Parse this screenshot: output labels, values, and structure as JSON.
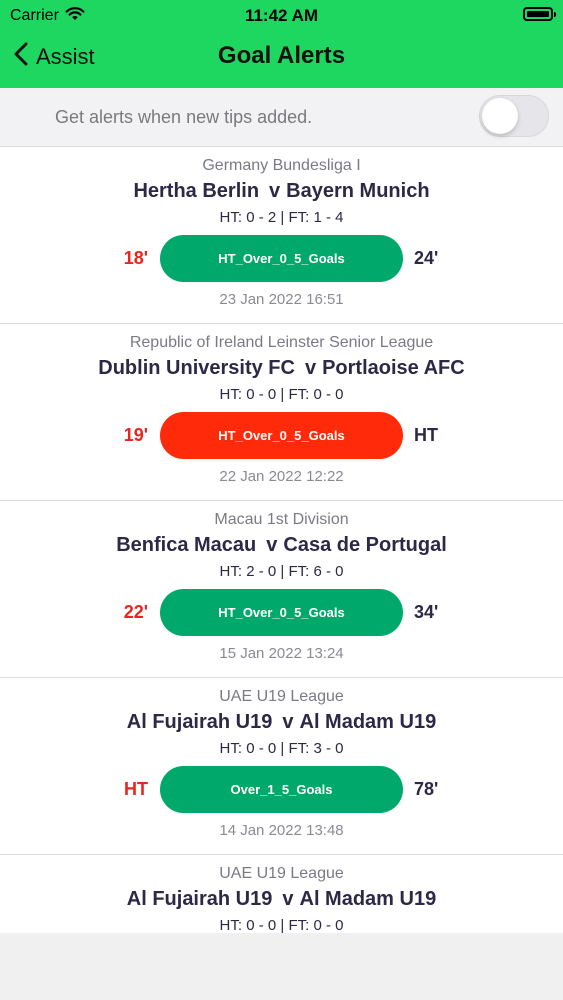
{
  "status_bar": {
    "carrier": "Carrier",
    "time": "11:42 AM",
    "wifi_icon": "wifi-icon",
    "battery_icon": "battery-icon"
  },
  "nav": {
    "back_label": "Assist",
    "title": "Goal Alerts"
  },
  "toggle": {
    "label": "Get alerts when new tips added.",
    "on": false
  },
  "colors": {
    "bar_green": "#1ed760",
    "pill_green": "#00a86b",
    "pill_red": "#ff2a0a",
    "minute_red": "#e8261c",
    "text_dark": "#2c2845"
  },
  "alerts": [
    {
      "league": "Germany Bundesliga I",
      "home": "Hertha Berlin",
      "vs": "v",
      "away": "Bayern Munich",
      "score": "HT: 0 - 2 | FT: 1 - 4",
      "tip_minute": "18'",
      "tip": "HT_Over_0_5_Goals",
      "result_minute": "24'",
      "date": "23 Jan 2022 16:51",
      "status": "won"
    },
    {
      "league": "Republic of Ireland Leinster Senior League",
      "home": "Dublin University FC",
      "vs": "v",
      "away": "Portlaoise AFC",
      "score": "HT: 0 - 0 | FT: 0 - 0",
      "tip_minute": "19'",
      "tip": "HT_Over_0_5_Goals",
      "result_minute": "HT",
      "date": "22 Jan 2022 12:22",
      "status": "lost"
    },
    {
      "league": "Macau 1st Division",
      "home": "Benfica Macau",
      "vs": "v",
      "away": "Casa de Portugal",
      "score": "HT: 2 - 0 | FT: 6 - 0",
      "tip_minute": "22'",
      "tip": "HT_Over_0_5_Goals",
      "result_minute": "34'",
      "date": "15 Jan 2022 13:24",
      "status": "won"
    },
    {
      "league": "UAE U19 League",
      "home": "Al Fujairah U19",
      "vs": "v",
      "away": "Al Madam U19",
      "score": "HT: 0 - 0 | FT: 3 - 0",
      "tip_minute": "HT",
      "tip": "Over_1_5_Goals",
      "result_minute": "78'",
      "date": "14 Jan 2022 13:48",
      "status": "won"
    },
    {
      "league": "UAE U19 League",
      "home": "Al Fujairah U19",
      "vs": "v",
      "away": "Al Madam U19",
      "score": "HT: 0 - 0 | FT: 0 - 0",
      "tip_minute": "",
      "tip": "",
      "result_minute": "",
      "date": "",
      "status": "pending"
    }
  ]
}
